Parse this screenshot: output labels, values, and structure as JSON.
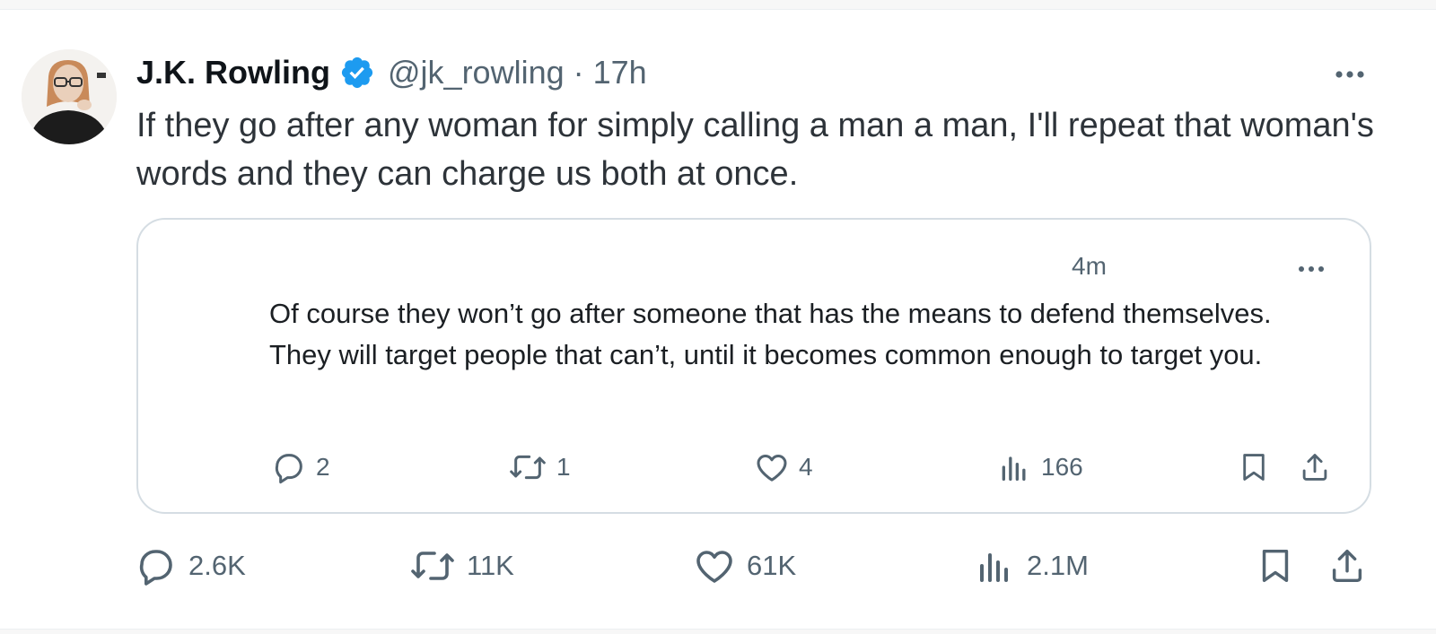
{
  "theme": {
    "text": "#0f1419",
    "secondary": "#536471",
    "verified": "#1d9bf0",
    "border": "#d5dde3"
  },
  "post": {
    "author_name": "J.K. Rowling",
    "handle": "@jk_rowling",
    "separator": "·",
    "time": "17h",
    "avatar_icon": "profile-photo",
    "verified_icon": "verified-badge-icon",
    "more_icon": "more-options-icon",
    "text": "If they go after any woman for simply calling a man a man, I'll repeat that woman's words and they can charge us both at once."
  },
  "quote": {
    "time": "4m",
    "more_icon": "more-options-icon",
    "text": "Of course they won’t go after someone that has the means to defend themselves. They will target people that can’t, until it becomes common enough to target you.",
    "actions": {
      "replies": "2",
      "reposts": "1",
      "likes": "4",
      "views": "166"
    }
  },
  "actions": {
    "replies": "2.6K",
    "reposts": "11K",
    "likes": "61K",
    "views": "2.1M",
    "icons": [
      "reply-icon",
      "repost-icon",
      "like-icon",
      "views-icon",
      "bookmark-icon",
      "share-icon"
    ]
  }
}
